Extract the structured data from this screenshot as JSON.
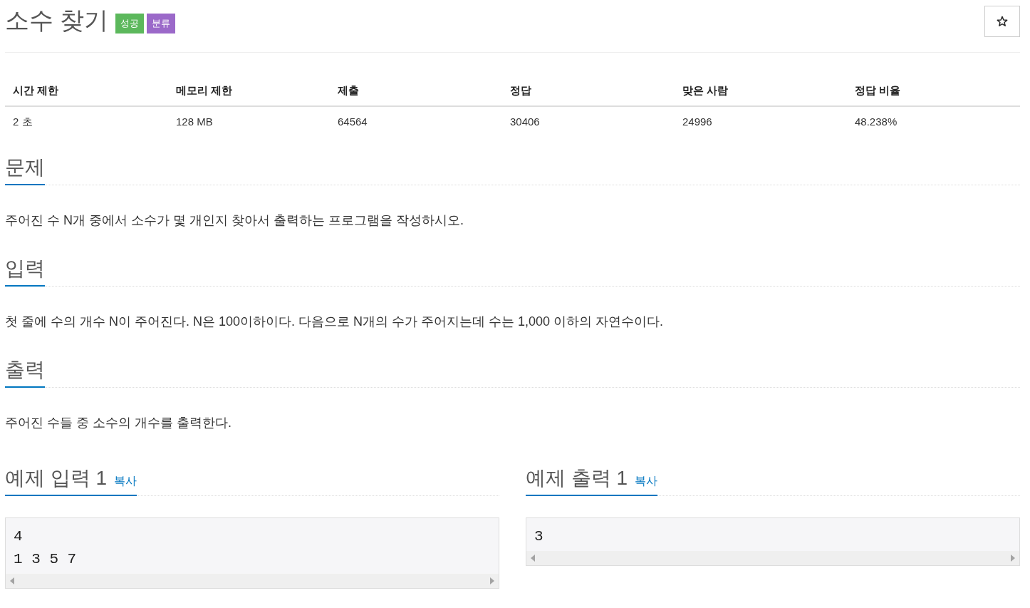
{
  "title": "소수 찾기",
  "labels": [
    {
      "text": "성공",
      "color": "#5cb85c"
    },
    {
      "text": "분류",
      "color": "#9b69c9"
    }
  ],
  "info_table": {
    "columns": [
      "시간 제한",
      "메모리 제한",
      "제출",
      "정답",
      "맞은 사람",
      "정답 비율"
    ],
    "rows": [
      [
        "2 초",
        "128 MB",
        "64564",
        "30406",
        "24996",
        "48.238%"
      ]
    ]
  },
  "sections": [
    {
      "heading": "문제",
      "body": "주어진 수 N개 중에서 소수가 몇 개인지 찾아서 출력하는 프로그램을 작성하시오."
    },
    {
      "heading": "입력",
      "body": "첫 줄에 수의 개수 N이 주어진다. N은 100이하이다. 다음으로 N개의 수가 주어지는데 수는 1,000 이하의 자연수이다."
    },
    {
      "heading": "출력",
      "body": "주어진 수들 중 소수의 개수를 출력한다."
    }
  ],
  "samples": [
    {
      "heading": "예제 입력 1",
      "copy": "복사",
      "lines": [
        "4",
        "1 3 5 7"
      ]
    },
    {
      "heading": "예제 출력 1",
      "copy": "복사",
      "lines": [
        "3"
      ]
    }
  ]
}
